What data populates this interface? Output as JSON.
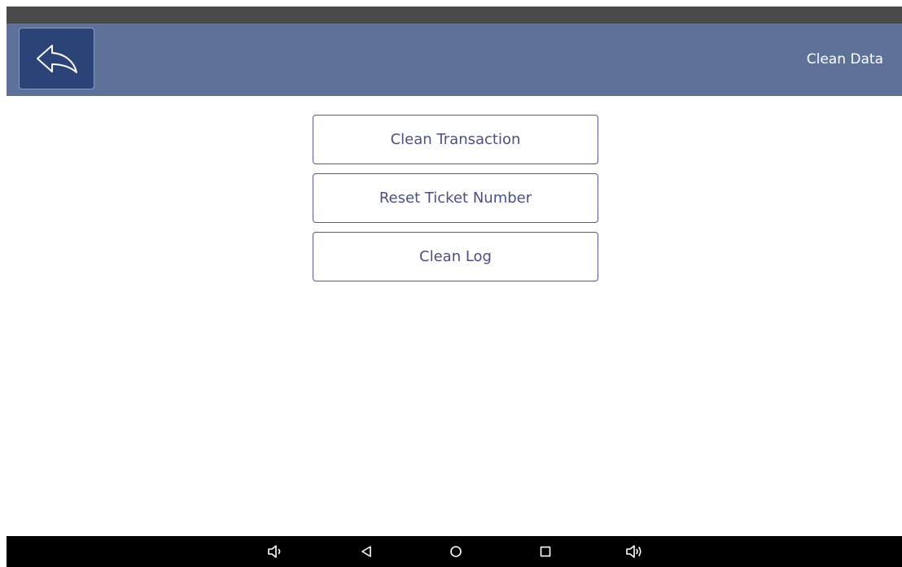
{
  "status_bar": {},
  "header": {
    "back_icon": "back-arrow-icon",
    "title": "Clean Data"
  },
  "actions": [
    {
      "label": "Clean Transaction"
    },
    {
      "label": "Reset Ticket Number"
    },
    {
      "label": "Clean Log"
    }
  ],
  "nav_bar": {
    "buttons": [
      {
        "icon": "volume-down-icon"
      },
      {
        "icon": "back-triangle-icon"
      },
      {
        "icon": "home-circle-icon"
      },
      {
        "icon": "recents-square-icon"
      },
      {
        "icon": "volume-up-icon"
      }
    ]
  },
  "colors": {
    "status_bar": "#4a4a4a",
    "header_bg": "#5e7199",
    "back_button_bg": "#2c4378",
    "action_text": "#4b4f86",
    "action_border": "#5b5b8a",
    "nav_bar_bg": "#000000"
  }
}
